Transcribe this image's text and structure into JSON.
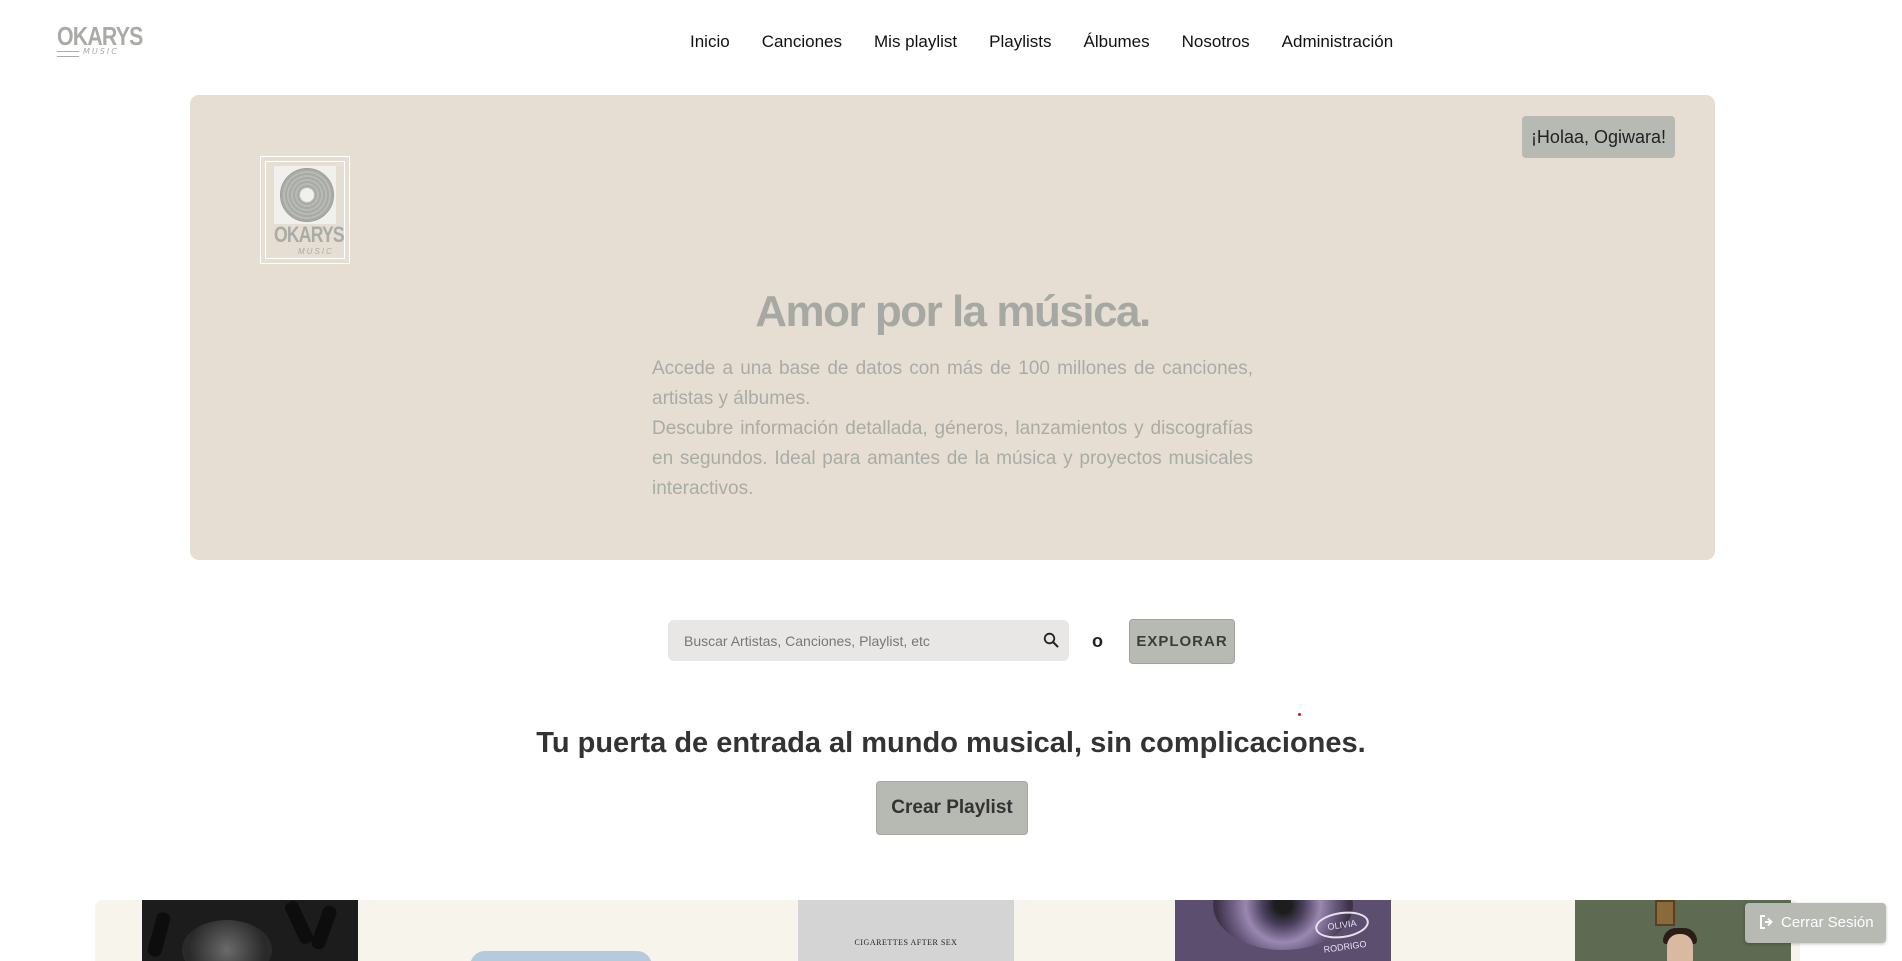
{
  "brand": {
    "name": "OKARYS",
    "tagline": "MUSIC"
  },
  "nav": {
    "items": [
      {
        "label": "Inicio"
      },
      {
        "label": "Canciones"
      },
      {
        "label": "Mis playlist"
      },
      {
        "label": "Playlists"
      },
      {
        "label": "Álbumes"
      },
      {
        "label": "Nosotros"
      },
      {
        "label": "Administración"
      }
    ]
  },
  "hero": {
    "greeting": "¡Holaa, Ogiwara!",
    "title": "Amor por la música.",
    "paragraph1": "Accede a una base de datos con más de 100 millones de canciones, artistas y álbumes.",
    "paragraph2": "Descubre información detallada, géneros, lanzamientos y discografías en segundos. Ideal para amantes de la música y proyectos musicales interactivos.",
    "background_color": "#e6ded3"
  },
  "search": {
    "placeholder": "Buscar Artistas, Canciones, Playlist, etc",
    "value": "",
    "or_label": "o",
    "explore_label": "EXPLORAR"
  },
  "main": {
    "tagline": "Tu puerta de entrada al mundo musical, sin complicaciones.",
    "create_playlist_label": "Crear Playlist"
  },
  "carousel": {
    "cards": [
      {
        "kind": "concert-crowd-cover"
      },
      {
        "kind": "blue-pill"
      },
      {
        "kind": "album-cover",
        "text": "CIGARETTES AFTER SEX"
      },
      {
        "kind": "album-cover",
        "text": "OLIVIA RODRIGO"
      },
      {
        "kind": "album-cover"
      }
    ]
  },
  "logout": {
    "label": "Cerrar Sesión",
    "icon": "sign-out-icon"
  },
  "colors": {
    "accent": "#b7b9b3",
    "hero_bg": "#e6ded3",
    "muted_text": "#a9aca6",
    "search_bg": "#e8e7e6"
  }
}
